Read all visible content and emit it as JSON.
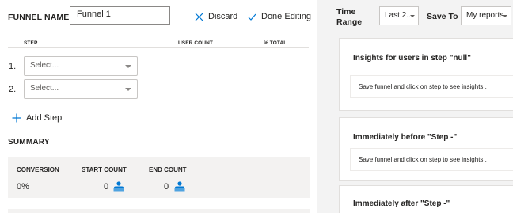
{
  "funnel": {
    "name_label": "FUNNEL NAME",
    "name_value": "Funnel 1"
  },
  "actions": {
    "discard_label": "Discard",
    "done_label": "Done Editing"
  },
  "steps_table": {
    "columns": [
      "STEP",
      "USER COUNT",
      "% TOTAL"
    ],
    "rows": [
      {
        "number": "1.",
        "placeholder": "Select..."
      },
      {
        "number": "2.",
        "placeholder": "Select..."
      }
    ],
    "add_step_label": "Add Step"
  },
  "summary": {
    "title": "SUMMARY",
    "conversion_label": "CONVERSION",
    "conversion_value": "0%",
    "start_label": "START COUNT",
    "start_value": "0",
    "end_label": "END COUNT",
    "end_value": "0"
  },
  "header_right": {
    "time_range_line1": "Time",
    "time_range_line2": "Range",
    "time_range_value": "Last 2...",
    "save_to_label": "Save To",
    "save_to_value": "My reports"
  },
  "insights": [
    {
      "title": "Insights for users in step \"null\"",
      "message": "Save funnel and click on step to see insights.."
    },
    {
      "title": "Immediately before \"Step -\"",
      "message": "Save funnel and click on step to see insights.."
    },
    {
      "title": "Immediately after \"Step -\"",
      "message": ""
    }
  ],
  "colors": {
    "accent": "#0078d4",
    "panel_bg": "#f3f3f3",
    "summary_bg": "#f3f2f1"
  }
}
